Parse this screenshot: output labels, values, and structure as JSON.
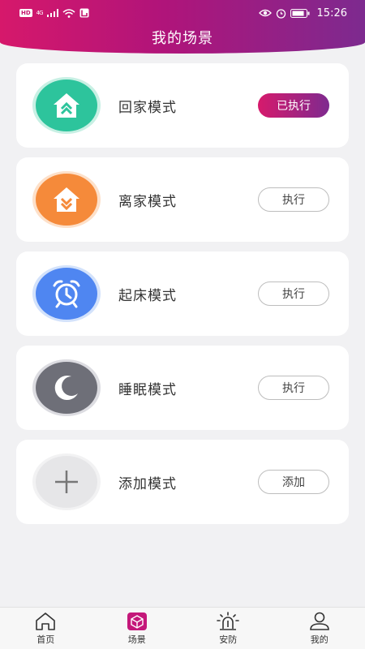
{
  "status_bar": {
    "left_badges": [
      "HD",
      "4G"
    ],
    "time": "15:26"
  },
  "header": {
    "title": "我的场景"
  },
  "colors": {
    "accent_start": "#d6186b",
    "accent_end": "#7d2a8f",
    "home_green": "#2dc49c",
    "away_orange": "#f58a3a",
    "wake_blue": "#4f86f1",
    "sleep_gray": "#6e6f78"
  },
  "scenes": [
    {
      "name": "回家模式",
      "icon": "home-up-icon",
      "button": "已执行",
      "executed": true
    },
    {
      "name": "离家模式",
      "icon": "home-down-icon",
      "button": "执行",
      "executed": false
    },
    {
      "name": "起床模式",
      "icon": "alarm-clock-icon",
      "button": "执行",
      "executed": false
    },
    {
      "name": "睡眠模式",
      "icon": "moon-icon",
      "button": "执行",
      "executed": false
    },
    {
      "name": "添加模式",
      "icon": "plus-icon",
      "button": "添加",
      "executed": false
    }
  ],
  "tabs": [
    {
      "label": "首页",
      "icon": "home-icon"
    },
    {
      "label": "场景",
      "icon": "scene-cube-icon",
      "selected": true
    },
    {
      "label": "安防",
      "icon": "alarm-light-icon"
    },
    {
      "label": "我的",
      "icon": "user-icon"
    }
  ]
}
